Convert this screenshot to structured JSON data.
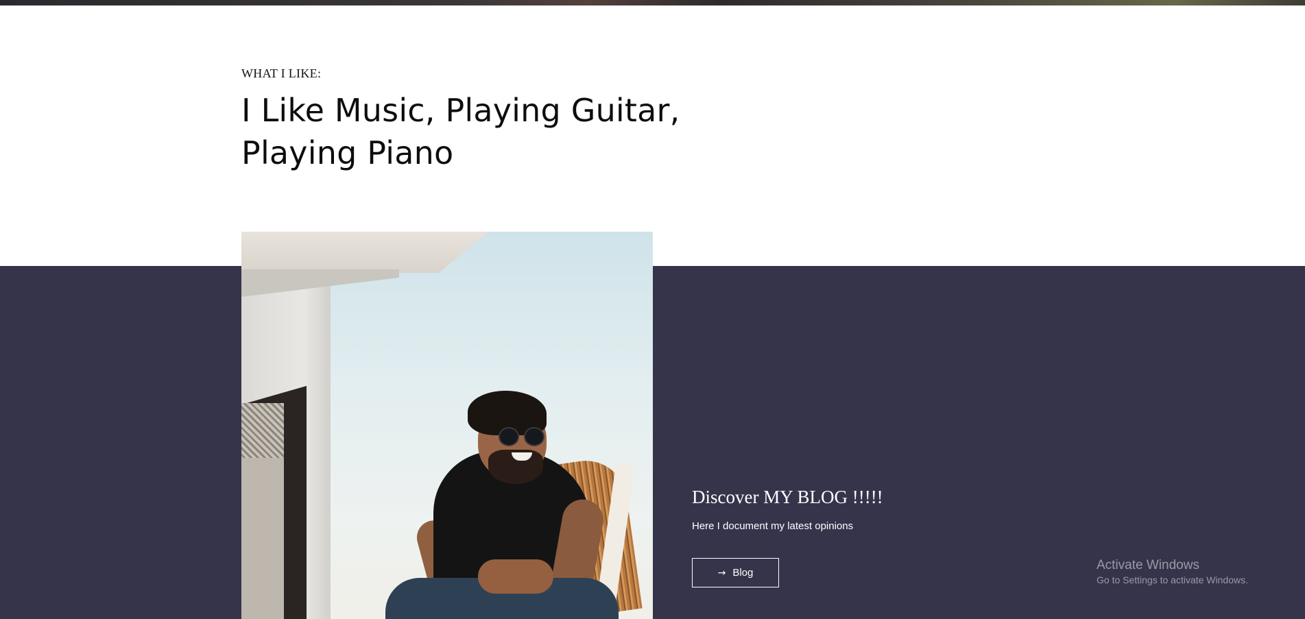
{
  "intro": {
    "eyebrow": "WHAT I LIKE:",
    "headline_line1": "I Like Music, Playing Guitar,",
    "headline_line2": "Playing Piano"
  },
  "photo": {
    "alt": "Smiling man with sunglasses sitting in a wicker chair"
  },
  "blog": {
    "title": "Discover MY BLOG !!!!!",
    "text": "Here I document my latest opinions",
    "button_label": "Blog",
    "button_icon": "arrow-right-icon"
  },
  "watermark": {
    "title": "Activate Windows",
    "subtitle": "Go to Settings to activate Windows."
  },
  "colors": {
    "band": "#35344b",
    "page_bg": "#ffffff",
    "text_dark": "#0d0d0d",
    "text_light": "#ffffff"
  }
}
